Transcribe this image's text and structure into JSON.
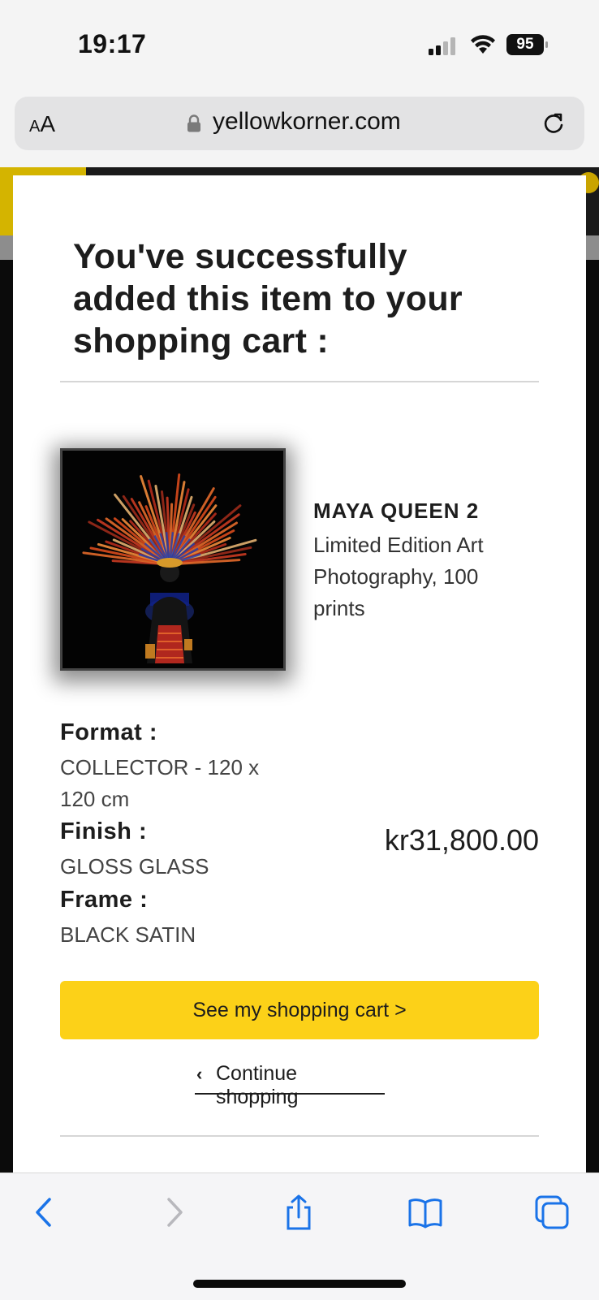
{
  "status_bar": {
    "time": "19:17",
    "battery": "95"
  },
  "browser": {
    "text_size_label_small": "A",
    "text_size_label_large": "A",
    "domain": "yellowkorner.com"
  },
  "modal": {
    "title": "You've successfully added this item to your shopping cart :",
    "product": {
      "name": "MAYA QUEEN 2",
      "description": "Limited Edition Art Photography, 100 prints"
    },
    "format": {
      "label": "Format :",
      "value": "COLLECTOR - 120 x 120 cm"
    },
    "finish": {
      "label": "Finish :",
      "value": "GLOSS GLASS"
    },
    "frame": {
      "label": "Frame :",
      "value": "BLACK SATIN"
    },
    "price": "kr31,800.00",
    "cart_button_label": "See my shopping cart >",
    "continue_label": "Continue shopping"
  },
  "colors": {
    "accent": "#fcd118",
    "ios_blue": "#1a73e8"
  },
  "toolbar_icons": [
    "back-icon",
    "forward-icon",
    "share-icon",
    "bookmarks-icon",
    "tabs-icon"
  ]
}
